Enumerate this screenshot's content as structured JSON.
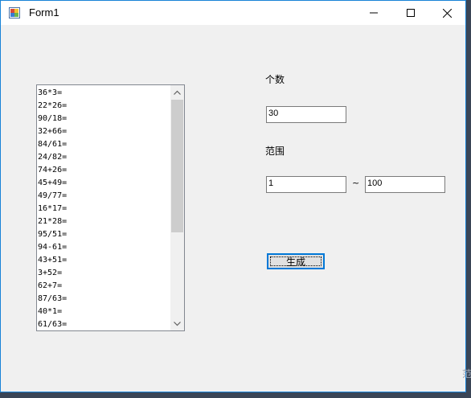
{
  "window": {
    "title": "Form1"
  },
  "list": {
    "items": [
      "36*3=",
      "22*26=",
      "90/18=",
      "32+66=",
      "84/61=",
      "24/82=",
      "74+26=",
      "45+49=",
      "49/77=",
      "16*17=",
      "21*28=",
      "95/51=",
      "94-61=",
      "43+51=",
      "3+52=",
      "62+7=",
      "87/63=",
      "40*1=",
      "61/63="
    ]
  },
  "form": {
    "count_label": "个数",
    "count_value": "30",
    "range_label": "范围",
    "range_min": "1",
    "range_sep": "~",
    "range_max": "100",
    "generate_label": "生成"
  },
  "background": {
    "partial_text": "范"
  },
  "colors": {
    "accent": "#0078d7",
    "window_bg": "#f0f0f0",
    "desktop_bg": "#3a4556"
  }
}
